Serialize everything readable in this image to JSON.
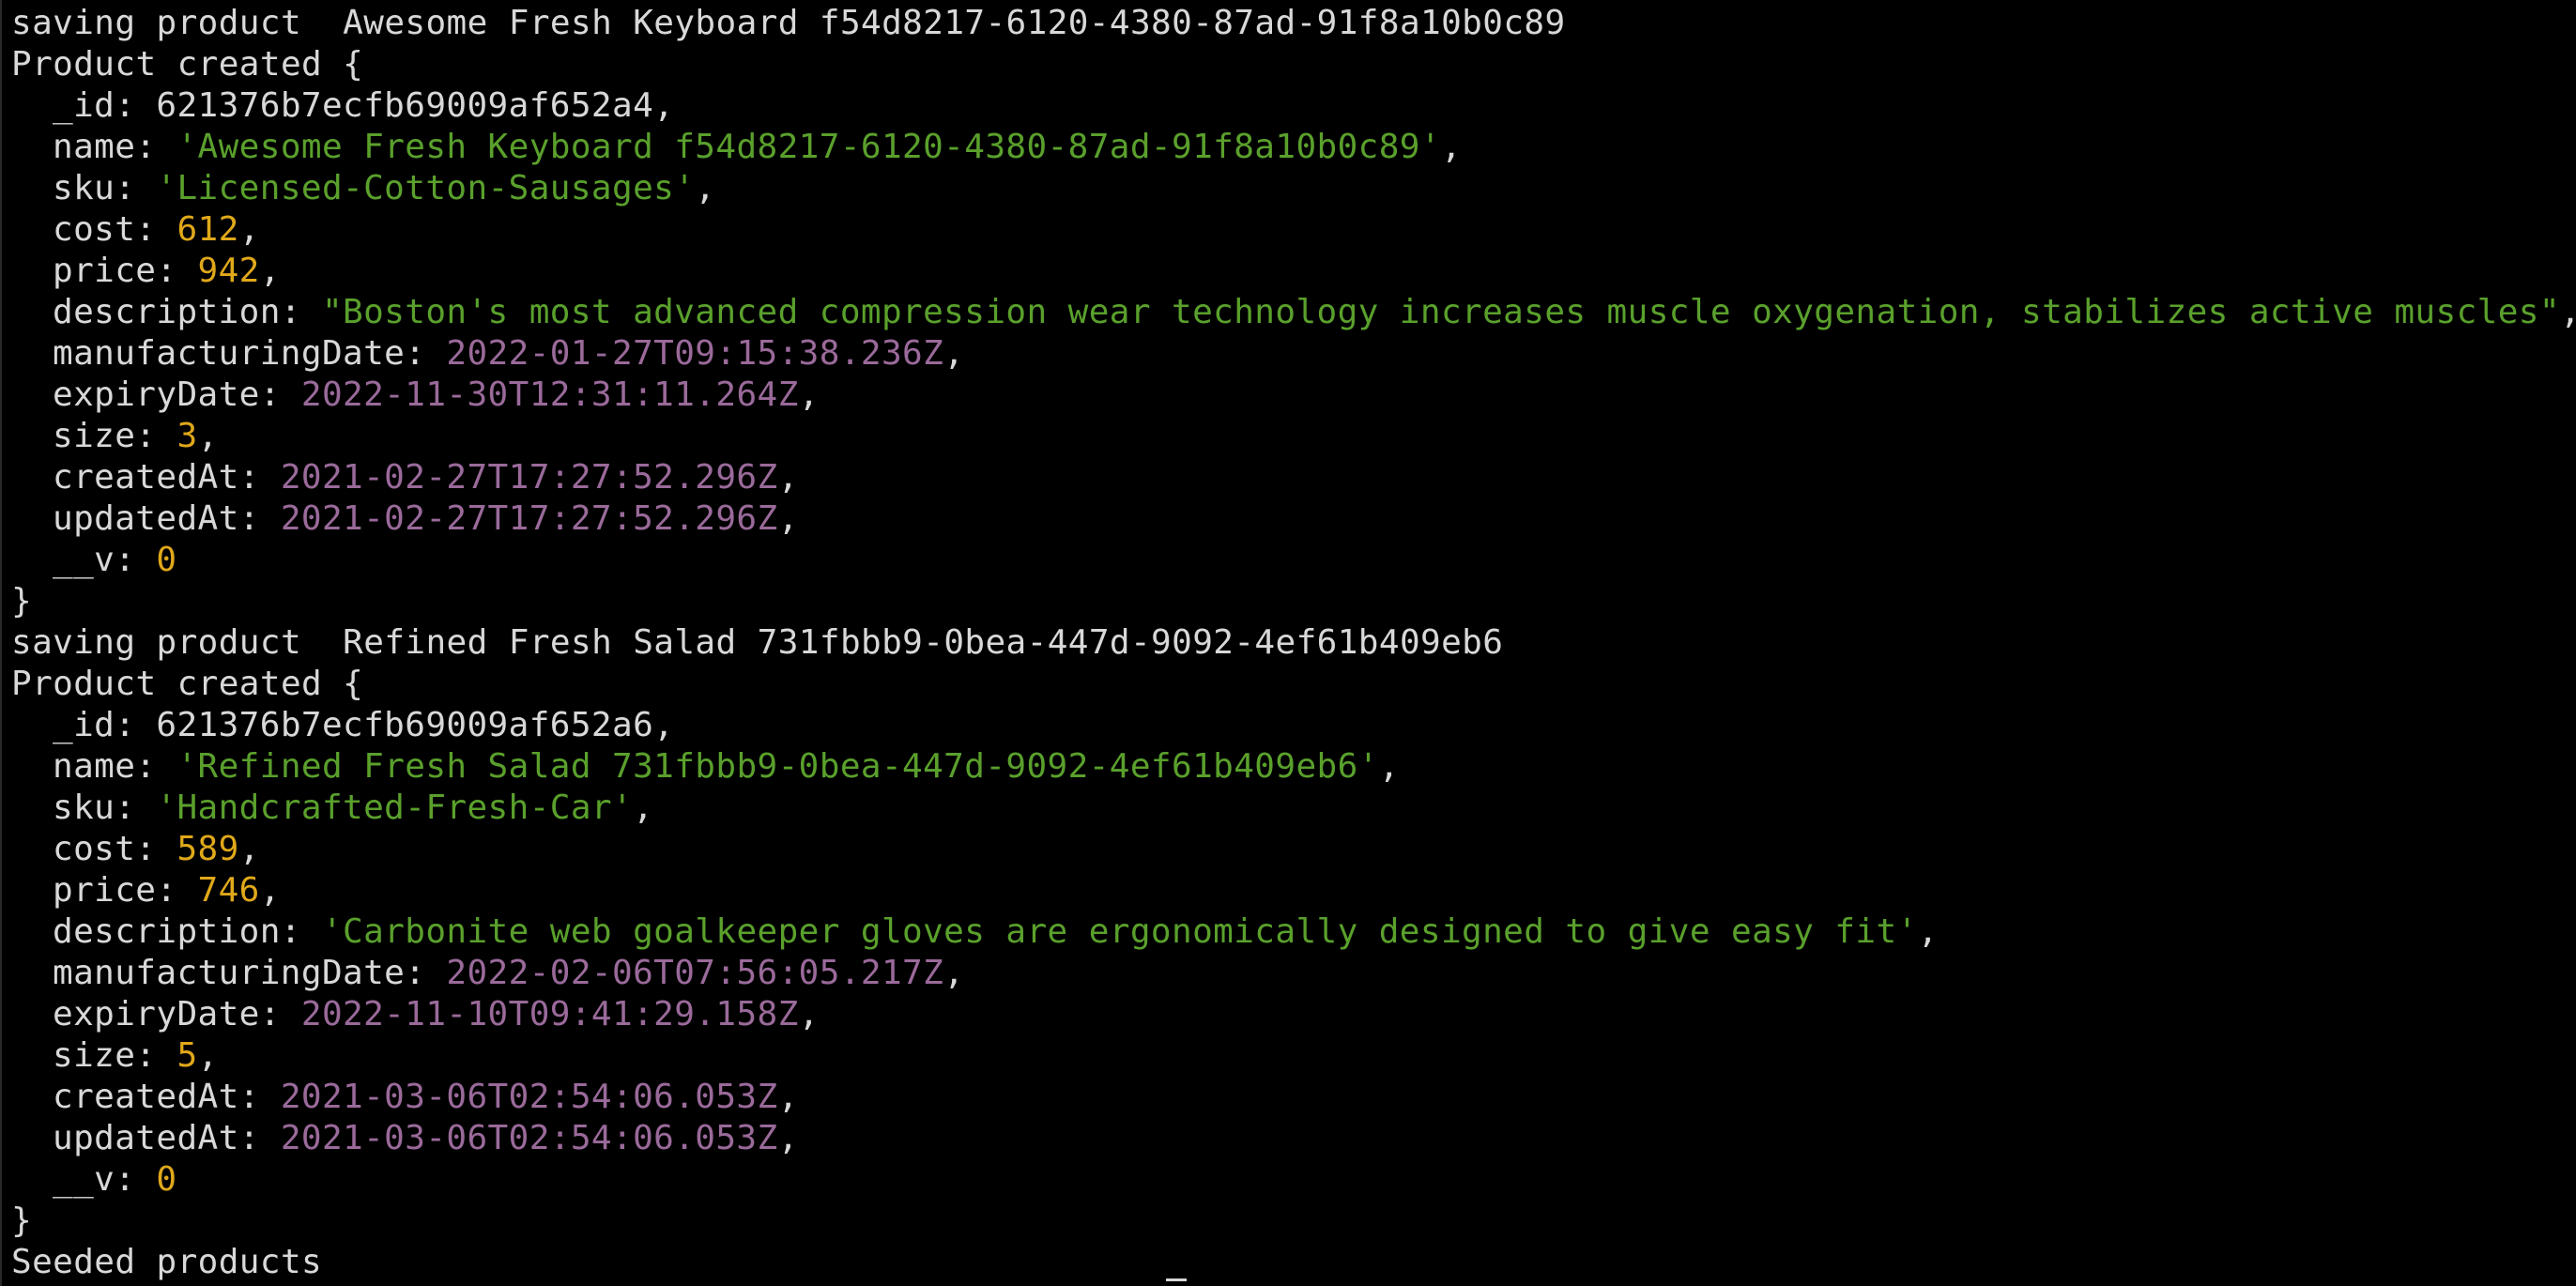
{
  "terminal": {
    "lines": [
      {
        "kind": "plain",
        "text": "saving product  Awesome Fresh Keyboard f54d8217-6120-4380-87ad-91f8a10b0c89"
      },
      {
        "kind": "plain",
        "text": "Product created {"
      },
      {
        "kind": "field",
        "key": "_id: ",
        "value": "621376b7ecfb69009af652a4",
        "type": "plain",
        "suffix": ","
      },
      {
        "kind": "field",
        "key": "name: ",
        "value": "'Awesome Fresh Keyboard f54d8217-6120-4380-87ad-91f8a10b0c89'",
        "type": "str",
        "suffix": ","
      },
      {
        "kind": "field",
        "key": "sku: ",
        "value": "'Licensed-Cotton-Sausages'",
        "type": "str",
        "suffix": ","
      },
      {
        "kind": "field",
        "key": "cost: ",
        "value": "612",
        "type": "num",
        "suffix": ","
      },
      {
        "kind": "field",
        "key": "price: ",
        "value": "942",
        "type": "num",
        "suffix": ","
      },
      {
        "kind": "field",
        "key": "description: ",
        "value": "\"Boston's most advanced compression wear technology increases muscle oxygenation, stabilizes active muscles\"",
        "type": "str",
        "suffix": ","
      },
      {
        "kind": "field",
        "key": "manufacturingDate: ",
        "value": "2022-01-27T09:15:38.236Z",
        "type": "date",
        "suffix": ","
      },
      {
        "kind": "field",
        "key": "expiryDate: ",
        "value": "2022-11-30T12:31:11.264Z",
        "type": "date",
        "suffix": ","
      },
      {
        "kind": "field",
        "key": "size: ",
        "value": "3",
        "type": "num",
        "suffix": ","
      },
      {
        "kind": "field",
        "key": "createdAt: ",
        "value": "2021-02-27T17:27:52.296Z",
        "type": "date",
        "suffix": ","
      },
      {
        "kind": "field",
        "key": "updatedAt: ",
        "value": "2021-02-27T17:27:52.296Z",
        "type": "date",
        "suffix": ","
      },
      {
        "kind": "field",
        "key": "__v: ",
        "value": "0",
        "type": "num",
        "suffix": ""
      },
      {
        "kind": "plain",
        "text": "}"
      },
      {
        "kind": "plain",
        "text": "saving product  Refined Fresh Salad 731fbbb9-0bea-447d-9092-4ef61b409eb6"
      },
      {
        "kind": "plain",
        "text": "Product created {"
      },
      {
        "kind": "field",
        "key": "_id: ",
        "value": "621376b7ecfb69009af652a6",
        "type": "plain",
        "suffix": ","
      },
      {
        "kind": "field",
        "key": "name: ",
        "value": "'Refined Fresh Salad 731fbbb9-0bea-447d-9092-4ef61b409eb6'",
        "type": "str",
        "suffix": ","
      },
      {
        "kind": "field",
        "key": "sku: ",
        "value": "'Handcrafted-Fresh-Car'",
        "type": "str",
        "suffix": ","
      },
      {
        "kind": "field",
        "key": "cost: ",
        "value": "589",
        "type": "num",
        "suffix": ","
      },
      {
        "kind": "field",
        "key": "price: ",
        "value": "746",
        "type": "num",
        "suffix": ","
      },
      {
        "kind": "field",
        "key": "description: ",
        "value": "'Carbonite web goalkeeper gloves are ergonomically designed to give easy fit'",
        "type": "str",
        "suffix": ","
      },
      {
        "kind": "field",
        "key": "manufacturingDate: ",
        "value": "2022-02-06T07:56:05.217Z",
        "type": "date",
        "suffix": ","
      },
      {
        "kind": "field",
        "key": "expiryDate: ",
        "value": "2022-11-10T09:41:29.158Z",
        "type": "date",
        "suffix": ","
      },
      {
        "kind": "field",
        "key": "size: ",
        "value": "5",
        "type": "num",
        "suffix": ","
      },
      {
        "kind": "field",
        "key": "createdAt: ",
        "value": "2021-03-06T02:54:06.053Z",
        "type": "date",
        "suffix": ","
      },
      {
        "kind": "field",
        "key": "updatedAt: ",
        "value": "2021-03-06T02:54:06.053Z",
        "type": "date",
        "suffix": ","
      },
      {
        "kind": "field",
        "key": "__v: ",
        "value": "0",
        "type": "num",
        "suffix": ""
      },
      {
        "kind": "plain",
        "text": "}"
      },
      {
        "kind": "plain",
        "text": "Seeded products"
      }
    ]
  },
  "colors": {
    "background": "#000000",
    "text": "#d8d8d8",
    "string": "#5aa02c",
    "number": "#e0a81a",
    "date": "#9a6a9a"
  }
}
